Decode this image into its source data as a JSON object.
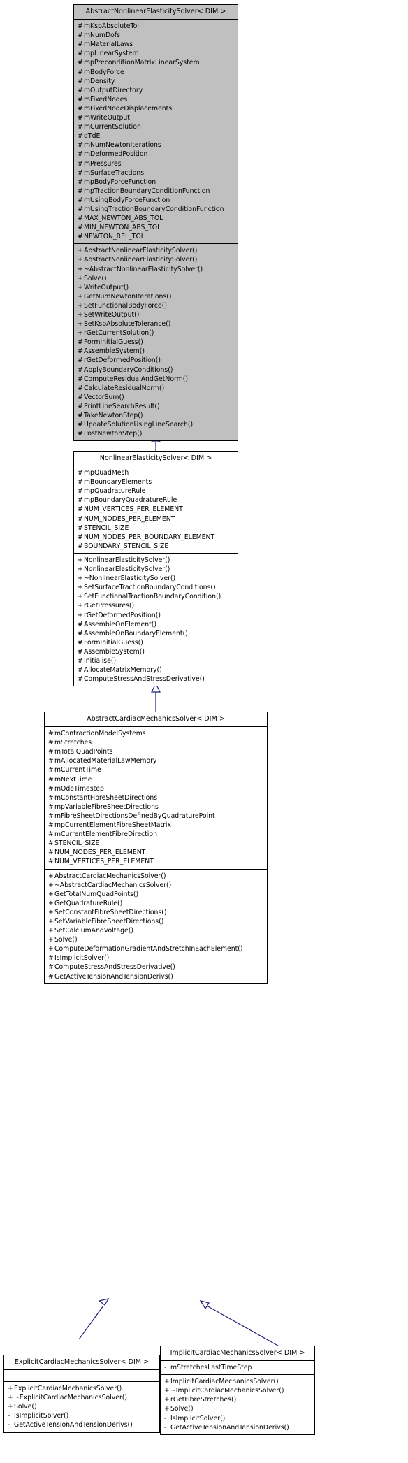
{
  "diagram": {
    "kind": "uml-class-inheritance-diagram",
    "background_color": "#ffffff",
    "abstract_fill_color": "#c0c0c0",
    "concrete_fill_color": "#ffffff",
    "border_color": "#000000",
    "edge_color": "#1f1f7a",
    "relationship": "generalization"
  },
  "classes": [
    {
      "id": "abstract-nonlinear-elasticity-solver",
      "name": "AbstractNonlinearElasticitySolver< DIM >",
      "filled": true,
      "attributes": [
        {
          "visibility": "#",
          "name": "mKspAbsoluteTol"
        },
        {
          "visibility": "#",
          "name": "mNumDofs"
        },
        {
          "visibility": "#",
          "name": "mMaterialLaws"
        },
        {
          "visibility": "#",
          "name": "mpLinearSystem"
        },
        {
          "visibility": "#",
          "name": "mpPreconditionMatrixLinearSystem"
        },
        {
          "visibility": "#",
          "name": "mBodyForce"
        },
        {
          "visibility": "#",
          "name": "mDensity"
        },
        {
          "visibility": "#",
          "name": "mOutputDirectory"
        },
        {
          "visibility": "#",
          "name": "mFixedNodes"
        },
        {
          "visibility": "#",
          "name": "mFixedNodeDisplacements"
        },
        {
          "visibility": "#",
          "name": "mWriteOutput"
        },
        {
          "visibility": "#",
          "name": "mCurrentSolution"
        },
        {
          "visibility": "#",
          "name": "dTdE"
        },
        {
          "visibility": "#",
          "name": "mNumNewtonIterations"
        },
        {
          "visibility": "#",
          "name": "mDeformedPosition"
        },
        {
          "visibility": "#",
          "name": "mPressures"
        },
        {
          "visibility": "#",
          "name": "mSurfaceTractions"
        },
        {
          "visibility": "#",
          "name": "mpBodyForceFunction"
        },
        {
          "visibility": "#",
          "name": "mpTractionBoundaryConditionFunction"
        },
        {
          "visibility": "#",
          "name": "mUsingBodyForceFunction"
        },
        {
          "visibility": "#",
          "name": "mUsingTractionBoundaryConditionFunction"
        },
        {
          "visibility": "#",
          "name": "MAX_NEWTON_ABS_TOL"
        },
        {
          "visibility": "#",
          "name": "MIN_NEWTON_ABS_TOL"
        },
        {
          "visibility": "#",
          "name": "NEWTON_REL_TOL"
        }
      ],
      "operations": [
        {
          "visibility": "+",
          "name": "AbstractNonlinearElasticitySolver()"
        },
        {
          "visibility": "+",
          "name": "AbstractNonlinearElasticitySolver()"
        },
        {
          "visibility": "+",
          "name": "~AbstractNonlinearElasticitySolver()"
        },
        {
          "visibility": "+",
          "name": "Solve()"
        },
        {
          "visibility": "+",
          "name": "WriteOutput()"
        },
        {
          "visibility": "+",
          "name": "GetNumNewtonIterations()"
        },
        {
          "visibility": "+",
          "name": "SetFunctionalBodyForce()"
        },
        {
          "visibility": "+",
          "name": "SetWriteOutput()"
        },
        {
          "visibility": "+",
          "name": "SetKspAbsoluteTolerance()"
        },
        {
          "visibility": "+",
          "name": "rGetCurrentSolution()"
        },
        {
          "visibility": "#",
          "name": "FormInitialGuess()"
        },
        {
          "visibility": "#",
          "name": "AssembleSystem()"
        },
        {
          "visibility": "#",
          "name": "rGetDeformedPosition()"
        },
        {
          "visibility": "#",
          "name": "ApplyBoundaryConditions()"
        },
        {
          "visibility": "#",
          "name": "ComputeResidualAndGetNorm()"
        },
        {
          "visibility": "#",
          "name": "CalculateResidualNorm()"
        },
        {
          "visibility": "#",
          "name": "VectorSum()"
        },
        {
          "visibility": "#",
          "name": "PrintLineSearchResult()"
        },
        {
          "visibility": "#",
          "name": "TakeNewtonStep()"
        },
        {
          "visibility": "#",
          "name": "UpdateSolutionUsingLineSearch()"
        },
        {
          "visibility": "#",
          "name": "PostNewtonStep()"
        }
      ]
    },
    {
      "id": "nonlinear-elasticity-solver",
      "name": "NonlinearElasticitySolver< DIM >",
      "filled": false,
      "attributes": [
        {
          "visibility": "#",
          "name": "mpQuadMesh"
        },
        {
          "visibility": "#",
          "name": "mBoundaryElements"
        },
        {
          "visibility": "#",
          "name": "mpQuadratureRule"
        },
        {
          "visibility": "#",
          "name": "mpBoundaryQuadratureRule"
        },
        {
          "visibility": "#",
          "name": "NUM_VERTICES_PER_ELEMENT"
        },
        {
          "visibility": "#",
          "name": "NUM_NODES_PER_ELEMENT"
        },
        {
          "visibility": "#",
          "name": "STENCIL_SIZE"
        },
        {
          "visibility": "#",
          "name": "NUM_NODES_PER_BOUNDARY_ELEMENT"
        },
        {
          "visibility": "#",
          "name": "BOUNDARY_STENCIL_SIZE"
        }
      ],
      "operations": [
        {
          "visibility": "+",
          "name": "NonlinearElasticitySolver()"
        },
        {
          "visibility": "+",
          "name": "NonlinearElasticitySolver()"
        },
        {
          "visibility": "+",
          "name": "~NonlinearElasticitySolver()"
        },
        {
          "visibility": "+",
          "name": "SetSurfaceTractionBoundaryConditions()"
        },
        {
          "visibility": "+",
          "name": "SetFunctionalTractionBoundaryCondition()"
        },
        {
          "visibility": "+",
          "name": "rGetPressures()"
        },
        {
          "visibility": "+",
          "name": "rGetDeformedPosition()"
        },
        {
          "visibility": "#",
          "name": "AssembleOnElement()"
        },
        {
          "visibility": "#",
          "name": "AssembleOnBoundaryElement()"
        },
        {
          "visibility": "#",
          "name": "FormInitialGuess()"
        },
        {
          "visibility": "#",
          "name": "AssembleSystem()"
        },
        {
          "visibility": "#",
          "name": "Initialise()"
        },
        {
          "visibility": "#",
          "name": "AllocateMatrixMemory()"
        },
        {
          "visibility": "#",
          "name": "ComputeStressAndStressDerivative()"
        }
      ]
    },
    {
      "id": "abstract-cardiac-mechanics-solver",
      "name": "AbstractCardiacMechanicsSolver< DIM >",
      "filled": false,
      "attributes": [
        {
          "visibility": "#",
          "name": "mContractionModelSystems"
        },
        {
          "visibility": "#",
          "name": "mStretches"
        },
        {
          "visibility": "#",
          "name": "mTotalQuadPoints"
        },
        {
          "visibility": "#",
          "name": "mAllocatedMaterialLawMemory"
        },
        {
          "visibility": "#",
          "name": "mCurrentTime"
        },
        {
          "visibility": "#",
          "name": "mNextTime"
        },
        {
          "visibility": "#",
          "name": "mOdeTimestep"
        },
        {
          "visibility": "#",
          "name": "mConstantFibreSheetDirections"
        },
        {
          "visibility": "#",
          "name": "mpVariableFibreSheetDirections"
        },
        {
          "visibility": "#",
          "name": "mFibreSheetDirectionsDefinedByQuadraturePoint"
        },
        {
          "visibility": "#",
          "name": "mpCurrentElementFibreSheetMatrix"
        },
        {
          "visibility": "#",
          "name": "mCurrentElementFibreDirection"
        },
        {
          "visibility": "#",
          "name": "STENCIL_SIZE"
        },
        {
          "visibility": "#",
          "name": "NUM_NODES_PER_ELEMENT"
        },
        {
          "visibility": "#",
          "name": "NUM_VERTICES_PER_ELEMENT"
        }
      ],
      "operations": [
        {
          "visibility": "+",
          "name": "AbstractCardiacMechanicsSolver()"
        },
        {
          "visibility": "+",
          "name": "~AbstractCardiacMechanicsSolver()"
        },
        {
          "visibility": "+",
          "name": "GetTotalNumQuadPoints()"
        },
        {
          "visibility": "+",
          "name": "GetQuadratureRule()"
        },
        {
          "visibility": "+",
          "name": "SetConstantFibreSheetDirections()"
        },
        {
          "visibility": "+",
          "name": "SetVariableFibreSheetDirections()"
        },
        {
          "visibility": "+",
          "name": "SetCalciumAndVoltage()"
        },
        {
          "visibility": "+",
          "name": "Solve()"
        },
        {
          "visibility": "+",
          "name": "ComputeDeformationGradientAndStretchInEachElement()"
        },
        {
          "visibility": "#",
          "name": "IsImplicitSolver()"
        },
        {
          "visibility": "#",
          "name": "ComputeStressAndStressDerivative()"
        },
        {
          "visibility": "#",
          "name": "GetActiveTensionAndTensionDerivs()"
        }
      ]
    },
    {
      "id": "explicit-cardiac-mechanics-solver",
      "name": "ExplicitCardiacMechanicsSolver< DIM >",
      "filled": false,
      "attributes": [],
      "operations": [
        {
          "visibility": "+",
          "name": "ExplicitCardiacMechanicsSolver()"
        },
        {
          "visibility": "+",
          "name": "~ExplicitCardiacMechanicsSolver()"
        },
        {
          "visibility": "+",
          "name": "Solve()"
        },
        {
          "visibility": "-",
          "name": "IsImplicitSolver()"
        },
        {
          "visibility": "-",
          "name": "GetActiveTensionAndTensionDerivs()"
        }
      ]
    },
    {
      "id": "implicit-cardiac-mechanics-solver",
      "name": "ImplicitCardiacMechanicsSolver< DIM >",
      "filled": false,
      "attributes": [
        {
          "visibility": "-",
          "name": "mStretchesLastTimeStep"
        }
      ],
      "operations": [
        {
          "visibility": "+",
          "name": "ImplicitCardiacMechanicsSolver()"
        },
        {
          "visibility": "+",
          "name": "~ImplicitCardiacMechanicsSolver()"
        },
        {
          "visibility": "+",
          "name": "rGetFibreStretches()"
        },
        {
          "visibility": "+",
          "name": "Solve()"
        },
        {
          "visibility": "-",
          "name": "IsImplicitSolver()"
        },
        {
          "visibility": "-",
          "name": "GetActiveTensionAndTensionDerivs()"
        }
      ]
    }
  ]
}
